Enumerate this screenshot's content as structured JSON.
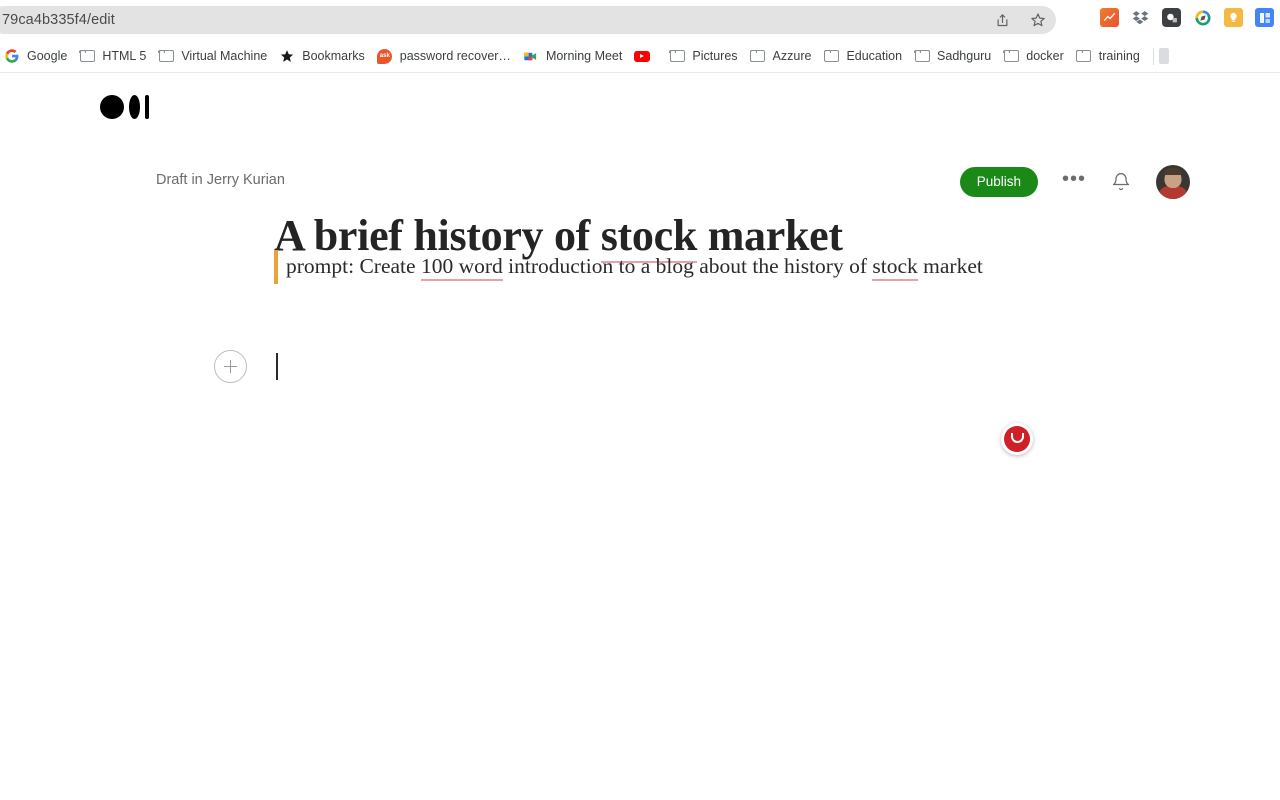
{
  "browser": {
    "url": "79ca4b335f4/edit",
    "omnibox_actions": [
      {
        "name": "share-icon",
        "glyph": "share"
      },
      {
        "name": "bookmark-star-icon",
        "glyph": "star"
      }
    ],
    "extensions": [
      {
        "name": "chart-extension-icon",
        "label": "",
        "color": "#e8542f"
      },
      {
        "name": "dropbox-extension-icon",
        "label": "",
        "color": "#4a7fd0"
      },
      {
        "name": "screen-capture-extension-icon",
        "label": "",
        "color": "#3c4043"
      },
      {
        "name": "compass-extension-icon",
        "label": "",
        "color": "#1a9d6e"
      },
      {
        "name": "lightbulb-extension-icon",
        "label": "",
        "color": "#f4b942"
      },
      {
        "name": "blue-app-extension-icon",
        "label": "",
        "color": "#4285f4"
      }
    ]
  },
  "bookmarks": {
    "items": [
      {
        "label": "Google",
        "icon": "google-icon"
      },
      {
        "label": "HTML 5",
        "icon": "folder-icon"
      },
      {
        "label": "Virtual Machine",
        "icon": "folder-icon"
      },
      {
        "label": "Bookmarks",
        "icon": "star-icon"
      },
      {
        "label": "password recover…",
        "icon": "ask-icon"
      },
      {
        "label": "Morning Meet",
        "icon": "meet-icon"
      },
      {
        "label": "",
        "icon": "youtube-icon"
      },
      {
        "label": "Pictures",
        "icon": "folder-icon"
      },
      {
        "label": "Azzure",
        "icon": "folder-icon"
      },
      {
        "label": "Education",
        "icon": "folder-icon"
      },
      {
        "label": "Sadhguru",
        "icon": "folder-icon"
      },
      {
        "label": "docker",
        "icon": "folder-icon"
      },
      {
        "label": "training",
        "icon": "folder-icon"
      }
    ]
  },
  "header": {
    "logo_name": "medium-logo",
    "draft_status": "Draft in Jerry Kurian",
    "publish_label": "Publish",
    "more_options_label": "•••",
    "notifications_name": "bell-icon",
    "avatar_name": "user-avatar"
  },
  "editor": {
    "title_parts": [
      {
        "text": "A brief history of ",
        "spellcheck_error": false
      },
      {
        "text": "stock",
        "spellcheck_error": true
      },
      {
        "text": " market",
        "spellcheck_error": false
      }
    ],
    "title_plain": "A brief history of stock market",
    "quote_parts": [
      {
        "text": "prompt: Create ",
        "spellcheck_error": false
      },
      {
        "text": "100 word",
        "spellcheck_error": true
      },
      {
        "text": " introduction to a blog about the history of ",
        "spellcheck_error": false
      },
      {
        "text": "stock",
        "spellcheck_error": true
      },
      {
        "text": " market",
        "spellcheck_error": false
      }
    ],
    "quote_plain": "prompt: Create 100 word introduction to a blog about the history of stock market",
    "add_block_label": "+",
    "accent_quote_color": "#e8a33d",
    "spellcheck_underline_color": "#e8a0ac"
  },
  "overlay": {
    "recording_indicator_name": "recording-indicator",
    "recording_color": "#cf2027"
  }
}
